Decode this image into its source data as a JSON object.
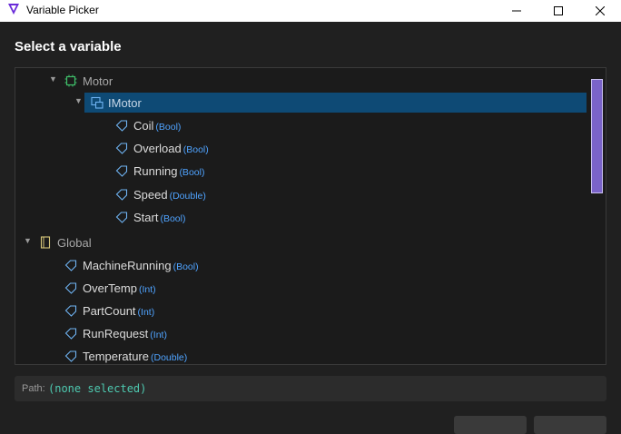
{
  "window": {
    "title": "Variable Picker"
  },
  "heading": "Select a variable",
  "tree": {
    "rows": [
      {
        "kind": "group",
        "name": "Motor",
        "type": "",
        "icon": "chip-icon",
        "caret": "▼"
      },
      {
        "kind": "group",
        "name": "IMotor",
        "type": "",
        "icon": "interface-icon",
        "caret": "▼",
        "selected": true
      },
      {
        "kind": "var",
        "name": "Coil",
        "type": "(Bool)",
        "icon": "tag-icon"
      },
      {
        "kind": "var",
        "name": "Overload",
        "type": "(Bool)",
        "icon": "tag-icon"
      },
      {
        "kind": "var",
        "name": "Running",
        "type": "(Bool)",
        "icon": "tag-icon"
      },
      {
        "kind": "var",
        "name": "Speed",
        "type": "(Double)",
        "icon": "tag-icon"
      },
      {
        "kind": "var",
        "name": "Start",
        "type": "(Bool)",
        "icon": "tag-icon"
      },
      {
        "kind": "group",
        "name": "Global",
        "type": "",
        "icon": "document-icon",
        "caret": "▼"
      },
      {
        "kind": "var",
        "name": "MachineRunning",
        "type": "(Bool)",
        "icon": "tag-icon"
      },
      {
        "kind": "var",
        "name": "OverTemp",
        "type": "(Int)",
        "icon": "tag-icon"
      },
      {
        "kind": "var",
        "name": "PartCount",
        "type": "(Int)",
        "icon": "tag-icon"
      },
      {
        "kind": "var",
        "name": "RunRequest",
        "type": "(Int)",
        "icon": "tag-icon"
      },
      {
        "kind": "var",
        "name": "Temperature",
        "type": "(Double)",
        "icon": "tag-icon"
      }
    ]
  },
  "path": {
    "label": "Path:",
    "value": "(none selected)"
  },
  "colors": {
    "accent": "#7a63c9",
    "type_blue": "#4fa3ff",
    "path_green": "#4ec9b0",
    "selected_bg": "#0e4a75"
  }
}
